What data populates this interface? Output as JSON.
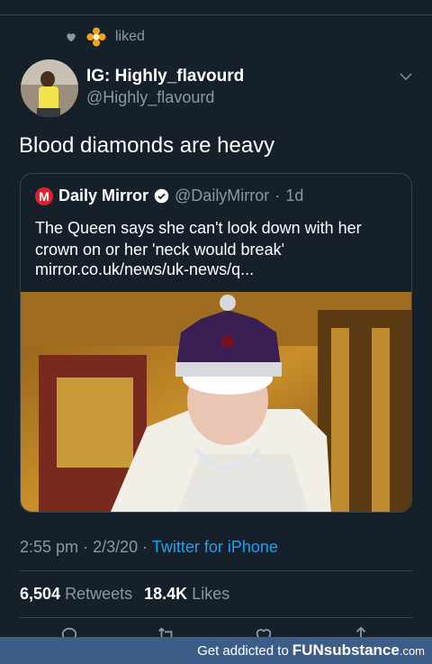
{
  "social_context": {
    "text": "liked"
  },
  "author": {
    "name": "IG: Highly_flavourd",
    "handle": "@Highly_flavourd"
  },
  "tweet": {
    "text": "Blood diamonds are heavy"
  },
  "quoted": {
    "name": "Daily Mirror",
    "handle": "@DailyMirror",
    "separator": "·",
    "time": "1d",
    "text": "The Queen says she can't look down with her crown on or her 'neck would break'",
    "link": "mirror.co.uk/news/uk-news/q...",
    "logo_letter": "M"
  },
  "meta": {
    "time": "2:55 pm",
    "date": "2/3/20",
    "source": "Twitter for iPhone",
    "sep": "·"
  },
  "stats": {
    "retweets": "6,504",
    "retweets_label": "Retweets",
    "likes": "18.4K",
    "likes_label": "Likes"
  },
  "watermark": {
    "prefix": "Get addicted to",
    "brand": "FUNsubstance",
    "domain": ".com"
  },
  "colors": {
    "background": "#15202b",
    "accent": "#1da1f2",
    "secondary_text": "#8899a6",
    "divider": "#38444d"
  }
}
